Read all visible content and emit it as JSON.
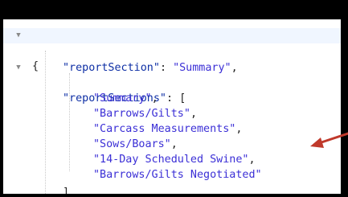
{
  "code": {
    "line1": {
      "brace": "{"
    },
    "line2": {
      "key": "\"reportSection\"",
      "sep": ": ",
      "value": "\"Summary\"",
      "end": ","
    },
    "line3": {
      "key": "\"reportSections\"",
      "sep": ": ",
      "bracket": "["
    },
    "items": [
      {
        "value": "\"Summary\"",
        "end": ","
      },
      {
        "value": "\"Barrows/Gilts\"",
        "end": ","
      },
      {
        "value": "\"Carcass Measurements\"",
        "end": ","
      },
      {
        "value": "\"Sows/Boars\"",
        "end": ","
      },
      {
        "value": "\"14-Day Scheduled Swine\"",
        "end": ","
      },
      {
        "value": "\"Barrows/Gilts Negotiated\"",
        "end": ""
      }
    ],
    "closing": {
      "bracket": "]",
      "end": ","
    }
  },
  "icons": {
    "fold_marker": "chevron-down-icon",
    "annotation": "red-arrow-icon"
  },
  "colors": {
    "key": "#0e2fa5",
    "string": "#3b2fd6",
    "arrow": "#c0392b",
    "active_line": "#f0f6ff"
  }
}
